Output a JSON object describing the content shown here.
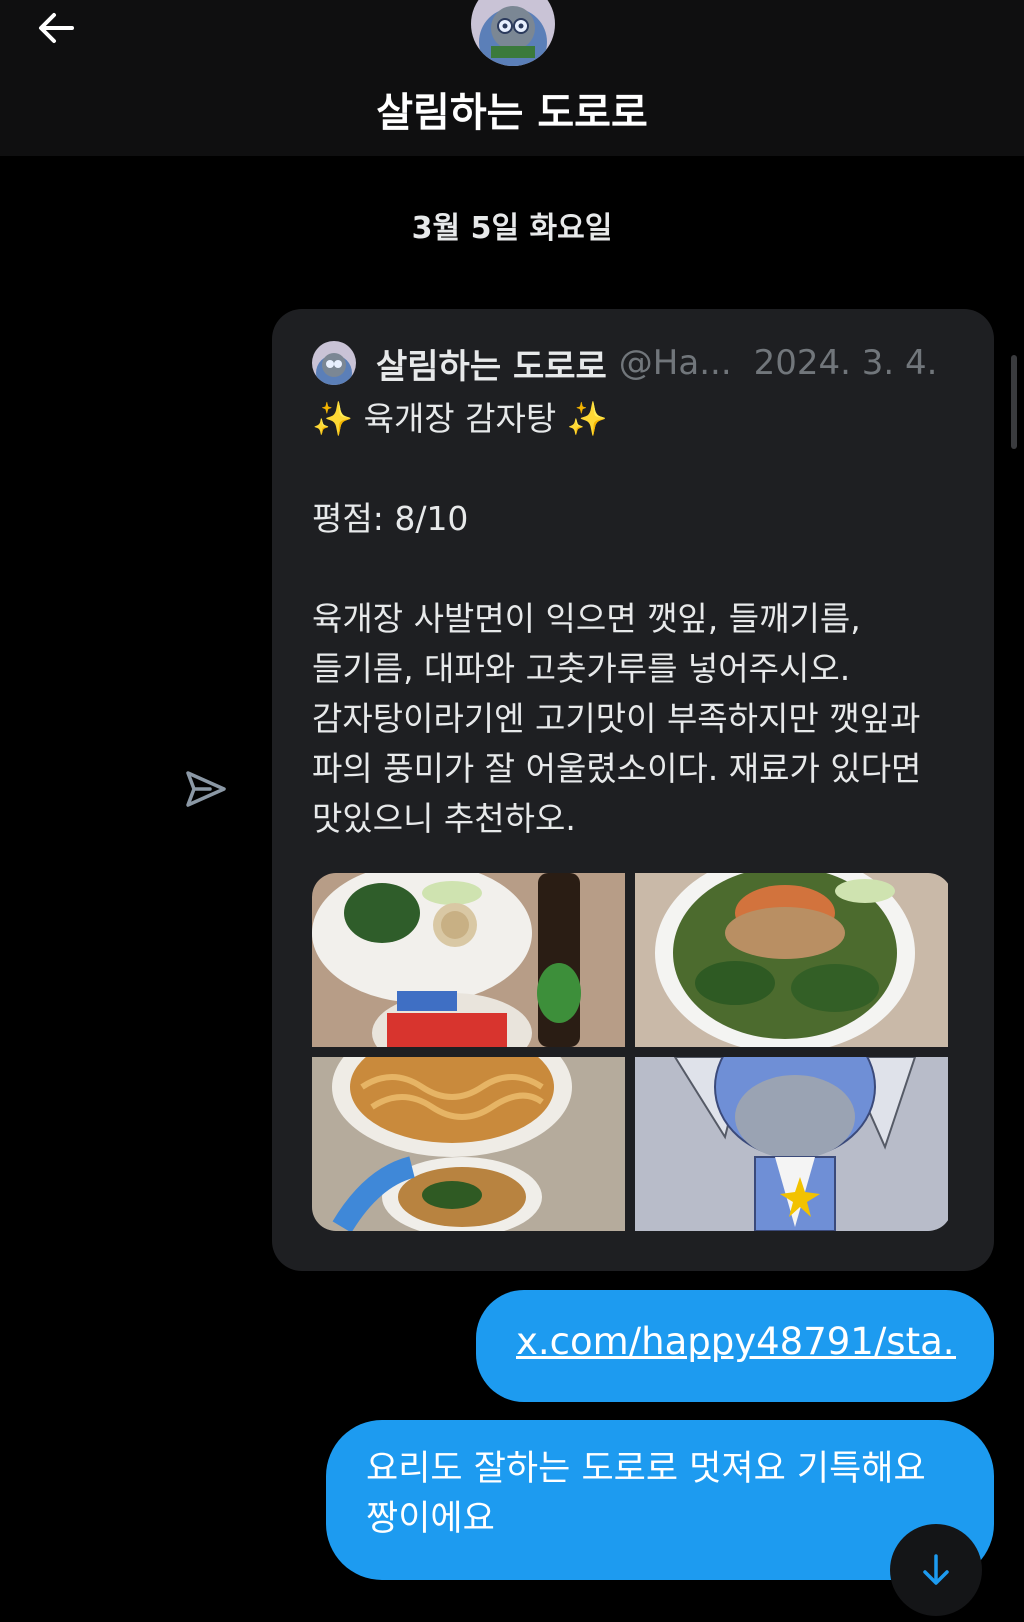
{
  "header": {
    "title": "살림하는 도로로",
    "back_icon": "arrow-left-icon"
  },
  "date_divider": "3월 5일 화요일",
  "shared_post": {
    "author": "살림하는 도로로",
    "handle": "@Ha...",
    "date": "2024. 3. 4.",
    "body": "✨ 육개장 감자탕 ✨\n\n평점: 8/10\n\n육개장 사발면이 익으면 깻잎, 들깨기름, 들기름, 대파와 고춧가루를 넣어주시오. 감자탕이라기엔 고기맛이 부족하지만 깻잎과 파의 풍미가 잘 어울렸소이다. 재료가 있다면 맛있으니 추천하오.",
    "images": [
      "ingredients-photo",
      "bowl-toppings-photo",
      "noodles-photo",
      "character-photo"
    ]
  },
  "messages": {
    "link": "x.com/happy48791/sta...",
    "text": "요리도 잘하는 도로로 멋져요 기특해요 짱이에요"
  },
  "colors": {
    "bubble": "#1d9bf0",
    "card": "#1e1f22",
    "background": "#000000"
  }
}
